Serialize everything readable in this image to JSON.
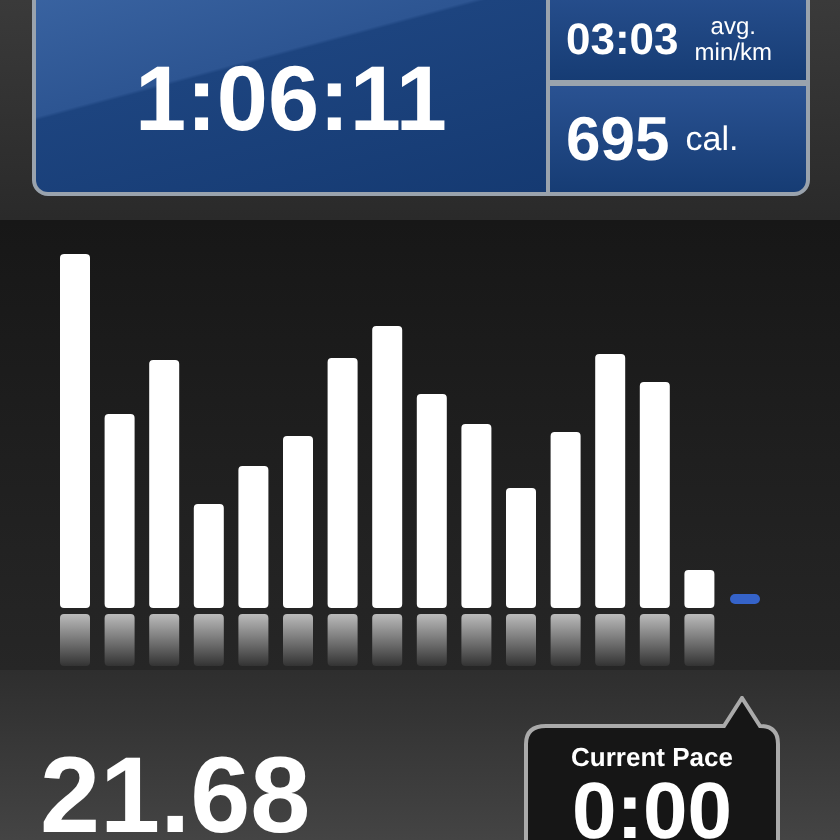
{
  "summary": {
    "duration": "1:06:11",
    "pace": {
      "value": "03:03",
      "label": "avg.",
      "unit": "min/km"
    },
    "calories": {
      "value": "695",
      "unit": "cal."
    }
  },
  "distance": "21.68",
  "current_pace": {
    "label": "Current Pace",
    "value": "0:00"
  }
}
